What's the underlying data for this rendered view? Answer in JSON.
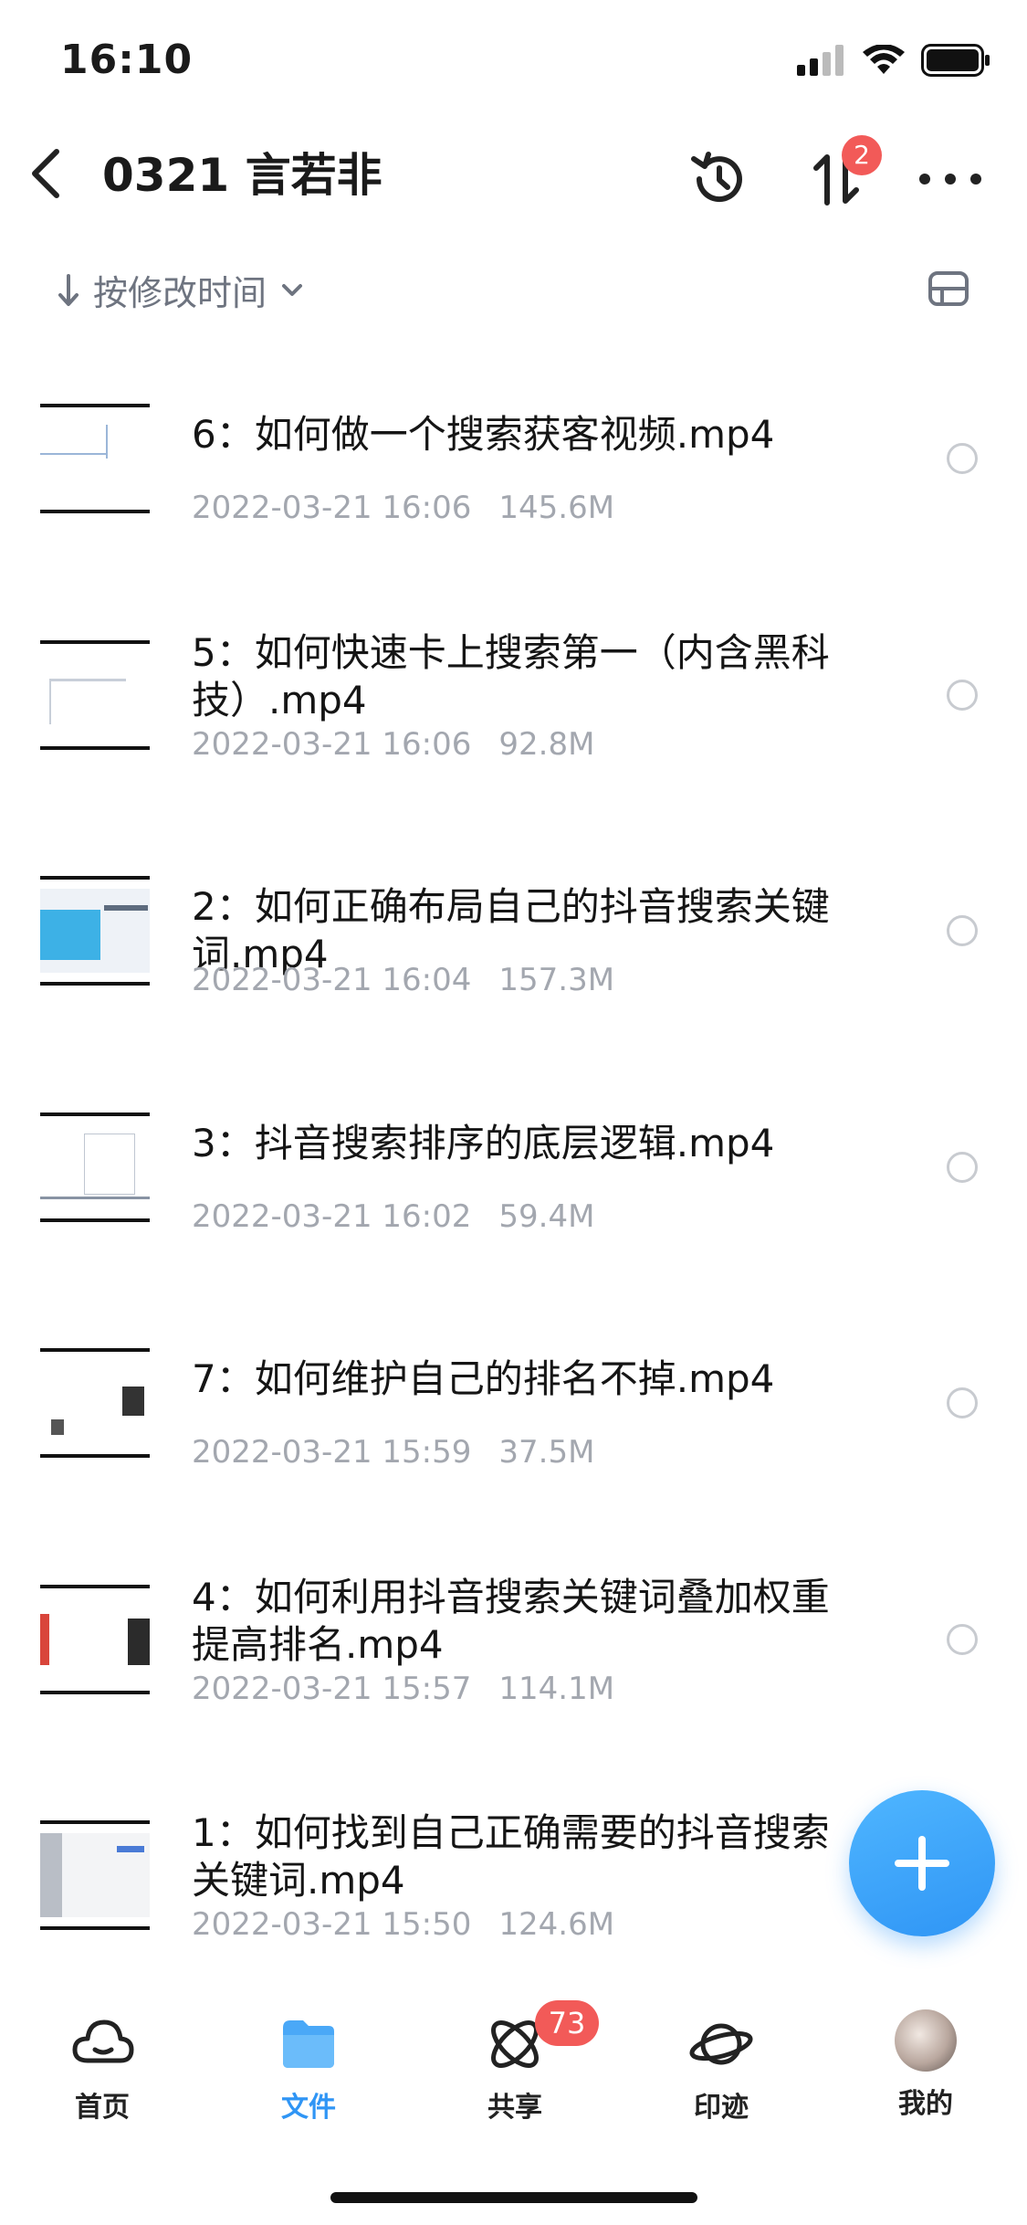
{
  "status_bar": {
    "time": "16:10"
  },
  "header": {
    "title": "0321 言若非",
    "transfer_badge": "2"
  },
  "sort": {
    "label": "按修改时间"
  },
  "files": [
    {
      "name": "6：如何做一个搜索获客视频.mp4",
      "date": "2022-03-21 16:06",
      "size": "145.6M"
    },
    {
      "name": "5：如何快速卡上搜索第一（内含黑科技）.mp4",
      "date": "2022-03-21 16:06",
      "size": "92.8M"
    },
    {
      "name": "2：如何正确布局自己的抖音搜索关键词.mp4",
      "date": "2022-03-21 16:04",
      "size": "157.3M"
    },
    {
      "name": "3：抖音搜索排序的底层逻辑.mp4",
      "date": "2022-03-21 16:02",
      "size": "59.4M"
    },
    {
      "name": "7：如何维护自己的排名不掉.mp4",
      "date": "2022-03-21 15:59",
      "size": "37.5M"
    },
    {
      "name": "4：如何利用抖音搜索关键词叠加权重提高排名.mp4",
      "date": "2022-03-21 15:57",
      "size": "114.1M"
    },
    {
      "name": "1：如何找到自己正确需要的抖音搜索关键词.mp4",
      "date": "2022-03-21 15:50",
      "size": "124.6M"
    }
  ],
  "tabbar": {
    "tabs": [
      {
        "label": "首页",
        "icon": "cloud-icon"
      },
      {
        "label": "文件",
        "icon": "folder-icon"
      },
      {
        "label": "共享",
        "icon": "share-atom-icon"
      },
      {
        "label": "印迹",
        "icon": "planet-icon"
      },
      {
        "label": "我的",
        "icon": "avatar"
      }
    ],
    "share_badge": "73",
    "active_color": "#2f95f5"
  },
  "colors": {
    "accent": "#2f95f5",
    "badge": "#f25a58",
    "meta_text": "#a3a7af"
  }
}
